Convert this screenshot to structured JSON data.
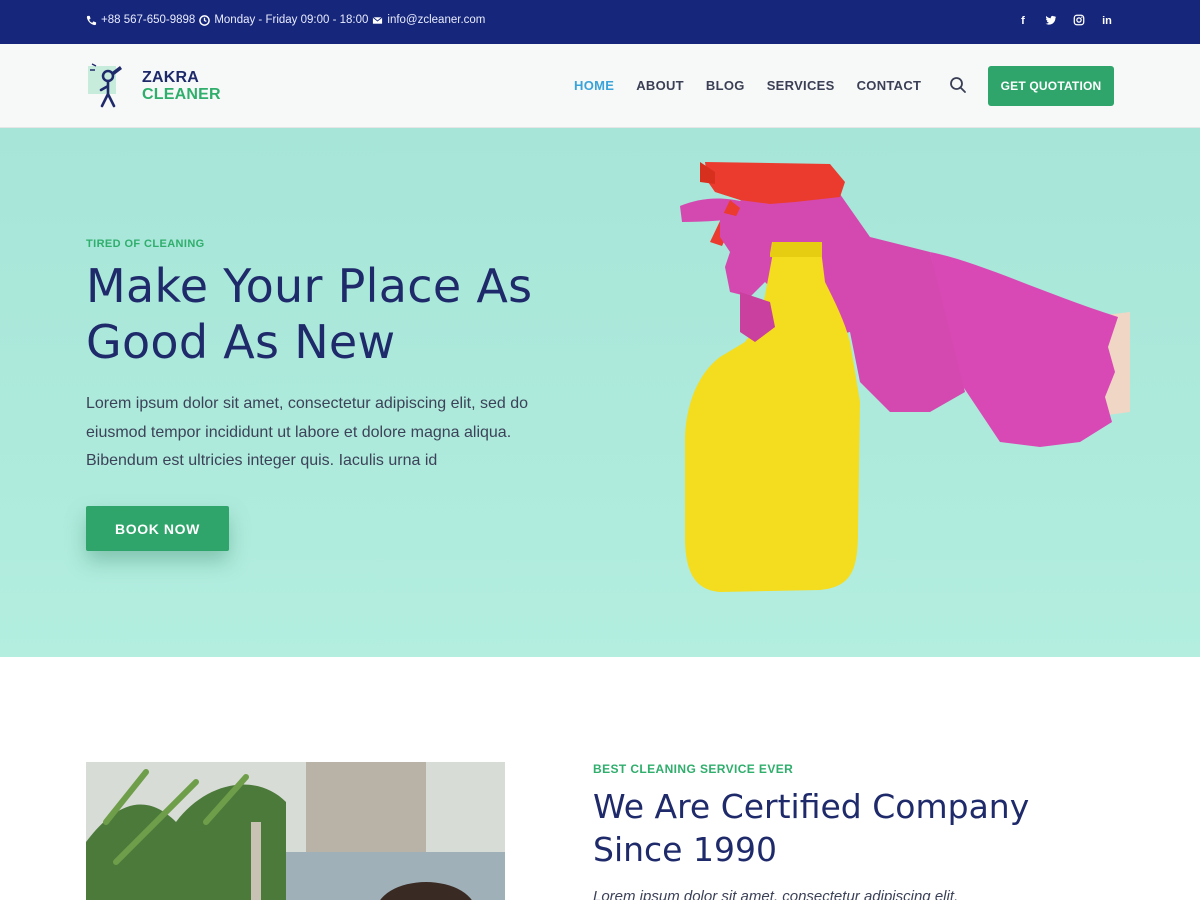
{
  "topbar": {
    "phone": "+88 567-650-9898",
    "hours": "Monday - Friday 09:00 - 18:00",
    "email": "info@zcleaner.com",
    "social": [
      "facebook-icon",
      "twitter-icon",
      "instagram-icon",
      "linkedin-icon"
    ],
    "social_labels": [
      "f",
      "t",
      "ig",
      "in"
    ]
  },
  "header": {
    "logo_line1": "ZAKRA",
    "logo_line2": "CLEANER",
    "nav": [
      "HOME",
      "ABOUT",
      "BLOG",
      "SERVICES",
      "CONTACT"
    ],
    "active_nav": "HOME",
    "cta": "GET QUOTATION"
  },
  "hero": {
    "eyebrow": "TIRED OF CLEANING",
    "title_line1": "Make Your Place As",
    "title_line2": "Good As New",
    "lead_line1": "Lorem ipsum dolor sit amet, consectetur adipiscing elit, sed do",
    "lead_line2": "eiusmod tempor incididunt ut labore et dolore magna aliqua.",
    "lead_line3": "Bibendum est ultricies integer quis. Iaculis urna id",
    "button": "BOOK NOW"
  },
  "about": {
    "eyebrow": "BEST CLEANING SERVICE EVER",
    "title_line1": "We Are Certified Company",
    "title_line2": "Since 1990",
    "para": "Lorem ipsum dolor sit amet, consectetur adipiscing elit,"
  },
  "colors": {
    "topbar": "#16267a",
    "accent_green": "#2fa56b",
    "heading_navy": "#1f2a6b",
    "nav_active": "#3aa3d9",
    "hero_bg": "#a6e5d8"
  }
}
